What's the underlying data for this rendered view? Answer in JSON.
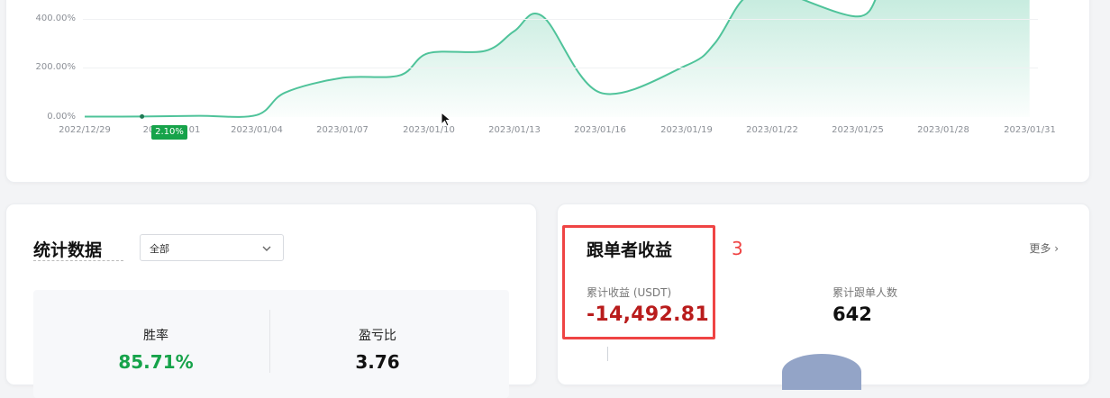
{
  "chart": {
    "y_ticks": [
      "400.00%",
      "200.00%",
      "0.00%"
    ],
    "x_ticks": [
      "2022/12/29",
      "20",
      "01",
      "2023/01/04",
      "2023/01/07",
      "2023/01/10",
      "2023/01/13",
      "2023/01/16",
      "2023/01/19",
      "2023/01/22",
      "2023/01/25",
      "2023/01/28",
      "2023/01/31"
    ],
    "tooltip": "2.10%",
    "line_color": "#4fc39a"
  },
  "chart_data": {
    "type": "area",
    "ylabel": "",
    "xlabel": "",
    "ylim": [
      0,
      500
    ],
    "x": [
      "2022/12/29",
      "2022/12/31",
      "2023/01/02",
      "2023/01/04",
      "2023/01/05",
      "2023/01/07",
      "2023/01/09",
      "2023/01/10",
      "2023/01/12",
      "2023/01/13",
      "2023/01/14",
      "2023/01/16",
      "2023/01/19",
      "2023/01/20",
      "2023/01/21",
      "2023/01/22",
      "2023/01/25",
      "2023/01/26",
      "2023/01/28",
      "2023/01/31"
    ],
    "series": [
      {
        "values": [
          2,
          2.1,
          5,
          8,
          100,
          160,
          170,
          260,
          270,
          350,
          410,
          100,
          210,
          300,
          480,
          520,
          410,
          530,
          505,
          520
        ]
      }
    ]
  },
  "stats": {
    "title": "统计数据",
    "filter_value": "全部",
    "win_rate_label": "胜率",
    "win_rate_value": "85.71%",
    "pl_ratio_label": "盈亏比",
    "pl_ratio_value": "3.76"
  },
  "follower": {
    "title": "跟单者收益",
    "more": "更多 ›",
    "cum_profit_label": "累计收益 (USDT)",
    "cum_profit_value": "-14,492.81",
    "follower_count_label": "累计跟单人数",
    "follower_count_value": "642"
  },
  "annotation": "3",
  "colors": {
    "profit_negative": "#b91c1c",
    "win_rate": "#16a34a",
    "highlight": "#ef4444"
  }
}
